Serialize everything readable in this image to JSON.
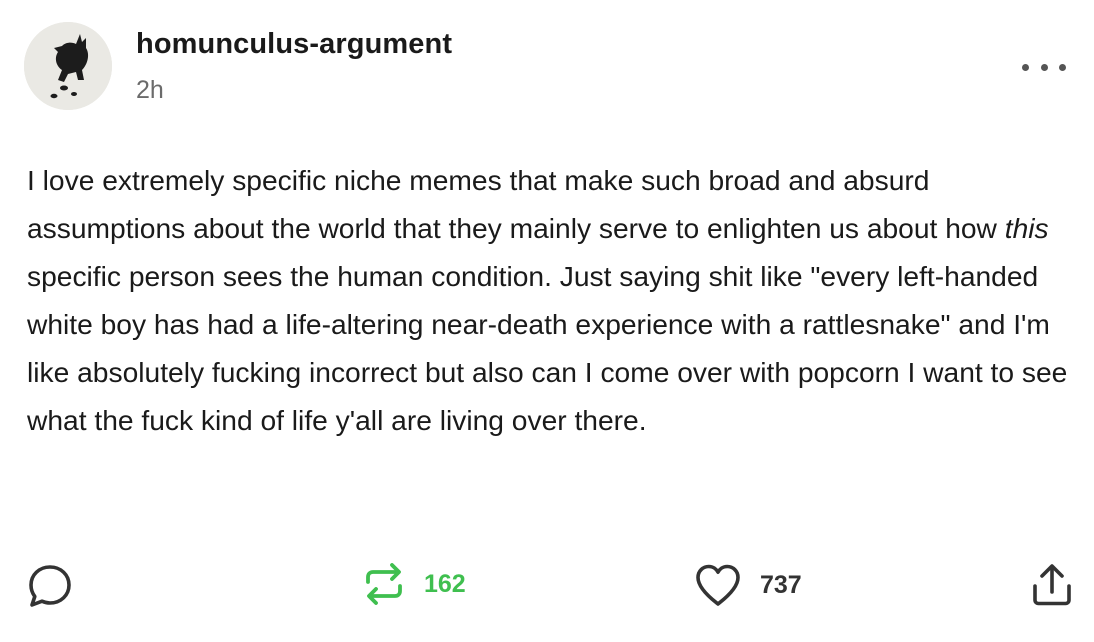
{
  "post": {
    "username": "homunculus-argument",
    "timestamp": "2h",
    "body_before": "I love extremely specific niche memes that make such broad and absurd assumptions about the world that they mainly serve to enlighten us about how ",
    "body_emphasis": "this",
    "body_after": " specific person sees the human condition. Just saying shit like \"every left-handed white boy has had a life-altering near-death experience with a rattlesnake\" and I'm like absolutely fucking incorrect but also can I come over with popcorn I want to see what the fuck kind of life y'all are living over there."
  },
  "actions": {
    "reply_icon": "speech-bubble-icon",
    "reblog_icon": "reblog-arrows-icon",
    "reblog_count": "162",
    "like_icon": "heart-icon",
    "like_count": "737",
    "share_icon": "share-upload-icon",
    "more_icon": "more-options-icon"
  },
  "colors": {
    "reblog_accent": "#3fbf4f",
    "text": "#1a1a1a",
    "muted": "#6b6b6b"
  }
}
